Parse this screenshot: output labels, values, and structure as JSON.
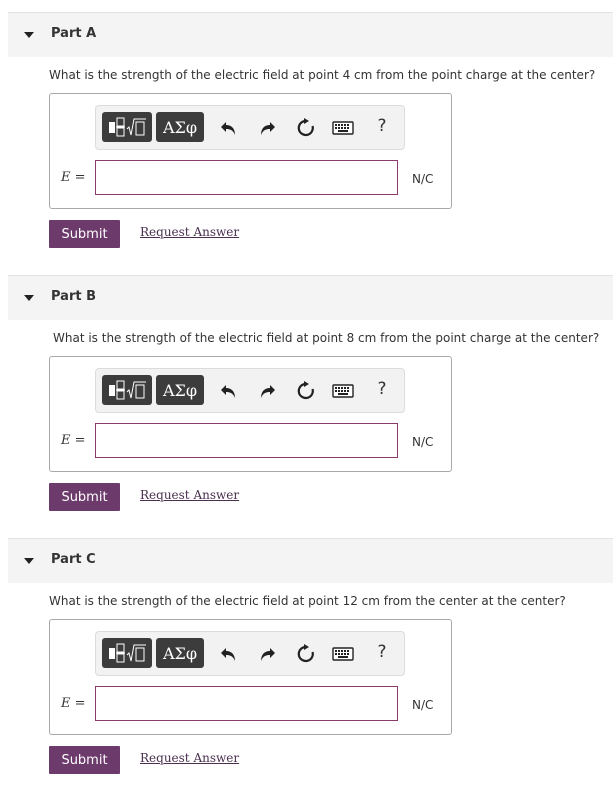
{
  "parts": [
    {
      "title": "Part A",
      "question": "What is the strength of the electric field at point 4 cm from the point charge at the center?",
      "var_label": "E",
      "equals": "=",
      "unit": "N/C",
      "input_value": "",
      "submit_label": "Submit",
      "request_label": "Request Answer"
    },
    {
      "title": "Part B",
      "question": "What is the strength of the electric field at point 8 cm from the point charge at the center?",
      "var_label": "E",
      "equals": "=",
      "unit": "N/C",
      "input_value": "",
      "submit_label": "Submit",
      "request_label": "Request Answer"
    },
    {
      "title": "Part C",
      "question": "What is the strength of the electric field at point 12 cm from the center at the center?",
      "var_label": "E",
      "equals": "=",
      "unit": "N/C",
      "input_value": "",
      "submit_label": "Submit",
      "request_label": "Request Answer"
    }
  ],
  "toolbar": {
    "greek_label": "ΑΣφ",
    "help_label": "?",
    "icons": [
      "templates-icon",
      "undo-icon",
      "redo-icon",
      "reset-icon",
      "keyboard-icon",
      "help-icon"
    ]
  },
  "colors": {
    "submit_bg": "#6d3a6c",
    "input_border": "#8b3a6b",
    "header_bg": "#f4f4f4"
  }
}
